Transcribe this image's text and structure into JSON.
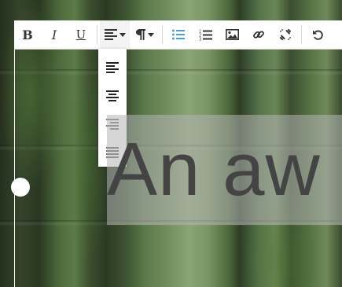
{
  "toolbar": {
    "bold_label": "B",
    "italic_label": "I",
    "underline_label": "U",
    "icons": {
      "align": "align-left-icon",
      "paragraph": "paragraph-icon",
      "bulleted_list": "bulleted-list-icon",
      "numbered_list": "numbered-list-icon",
      "image": "image-icon",
      "link": "link-icon",
      "unlink": "unlink-icon",
      "undo": "undo-icon"
    }
  },
  "align_dropdown": {
    "options": [
      "align-left-icon",
      "align-center-icon",
      "align-right-icon",
      "align-justify-icon"
    ],
    "selected": "align-left-icon"
  },
  "content": {
    "headline": "An aw"
  },
  "colors": {
    "list_icon_accent": "#4a9fd8",
    "toolbar_bg": "#ffffff",
    "headline_text": "#444444"
  }
}
